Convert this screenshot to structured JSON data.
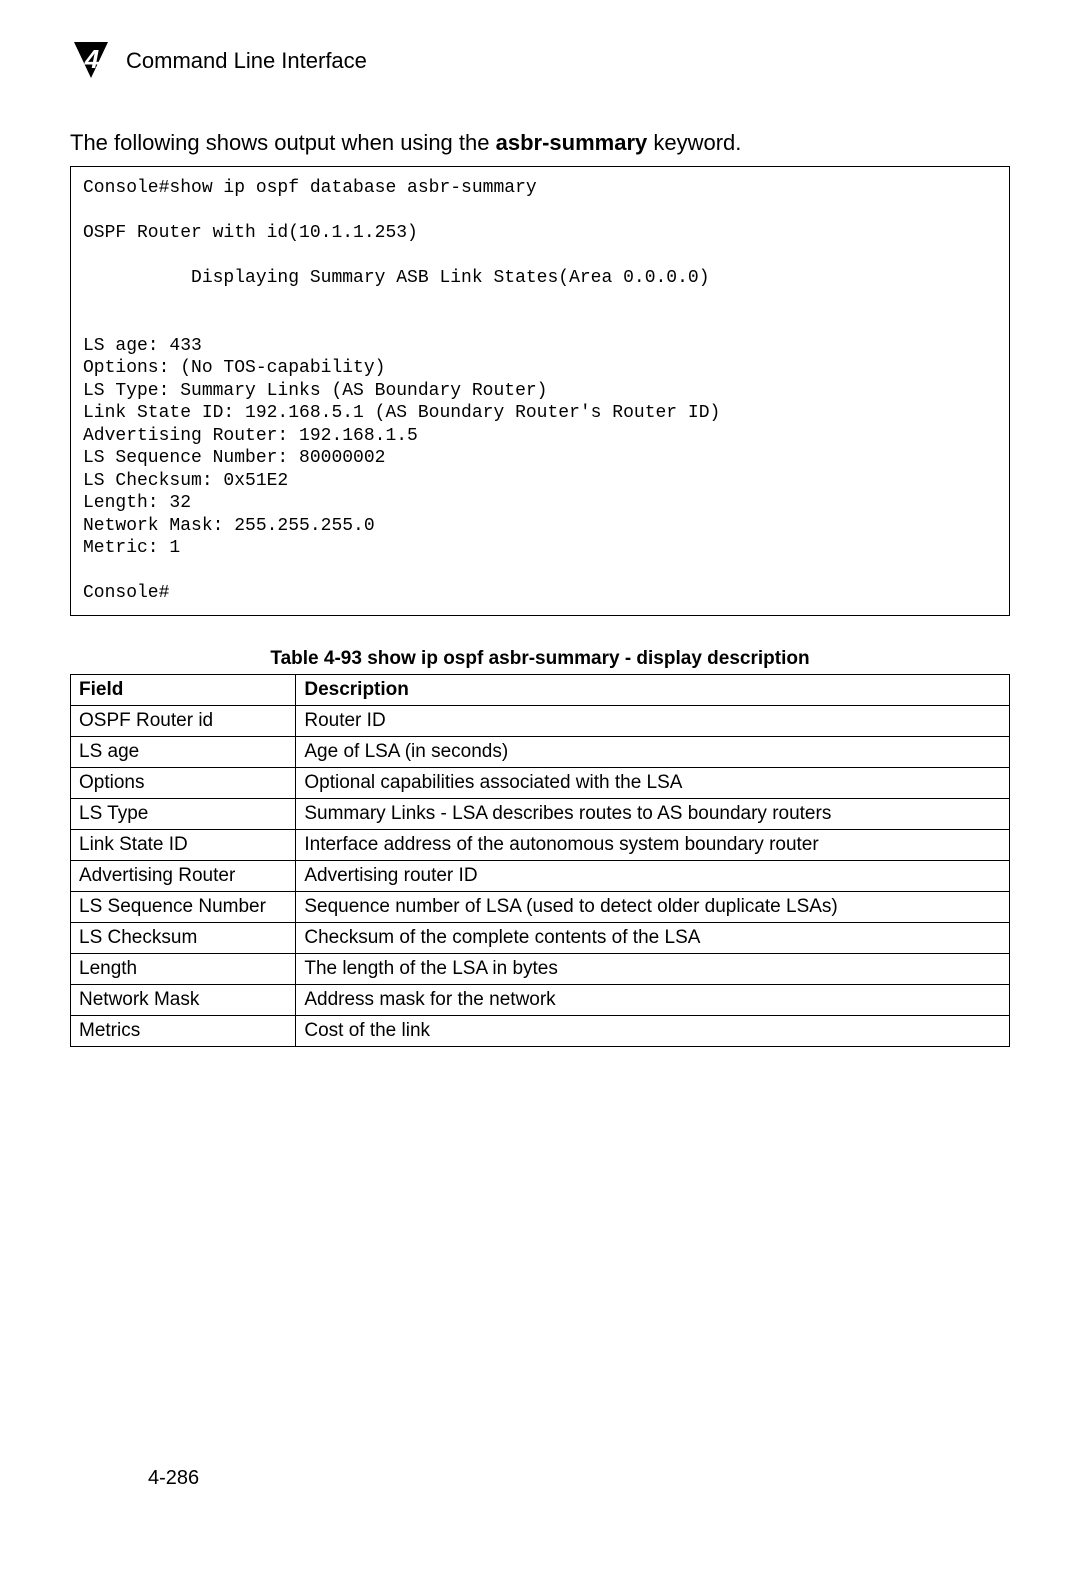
{
  "header": {
    "chapter_number": "4",
    "title": "Command Line Interface"
  },
  "intro": {
    "prefix": "The following shows output when using the ",
    "keyword": "asbr-summary",
    "suffix": " keyword."
  },
  "console_output": "Console#show ip ospf database asbr-summary\n\nOSPF Router with id(10.1.1.253)\n\n          Displaying Summary ASB Link States(Area 0.0.0.0)\n\n\nLS age: 433\nOptions: (No TOS-capability)\nLS Type: Summary Links (AS Boundary Router)\nLink State ID: 192.168.5.1 (AS Boundary Router's Router ID)\nAdvertising Router: 192.168.1.5\nLS Sequence Number: 80000002\nLS Checksum: 0x51E2\nLength: 32\nNetwork Mask: 255.255.255.0\nMetric: 1\n\nConsole#",
  "table": {
    "caption": "Table 4-93   show ip ospf asbr-summary - display description",
    "headers": {
      "field": "Field",
      "description": "Description"
    },
    "rows": [
      {
        "field": "OSPF Router id",
        "description": "Router ID"
      },
      {
        "field": "LS age",
        "description": "Age of LSA (in seconds)"
      },
      {
        "field": "Options",
        "description": "Optional capabilities associated with the LSA"
      },
      {
        "field": "LS Type",
        "description": "Summary Links - LSA describes routes to AS boundary routers"
      },
      {
        "field": "Link State ID",
        "description": "Interface address of the autonomous system boundary router"
      },
      {
        "field": "Advertising Router",
        "description": "Advertising router ID"
      },
      {
        "field": "LS Sequence Number",
        "description": "Sequence number of LSA (used to detect older duplicate LSAs)"
      },
      {
        "field": "LS Checksum",
        "description": "Checksum of the complete contents of the LSA"
      },
      {
        "field": "Length",
        "description": "The length of the LSA in bytes"
      },
      {
        "field": "Network Mask",
        "description": "Address mask for the network"
      },
      {
        "field": "Metrics",
        "description": "Cost of the link"
      }
    ]
  },
  "page_number": "4-286"
}
